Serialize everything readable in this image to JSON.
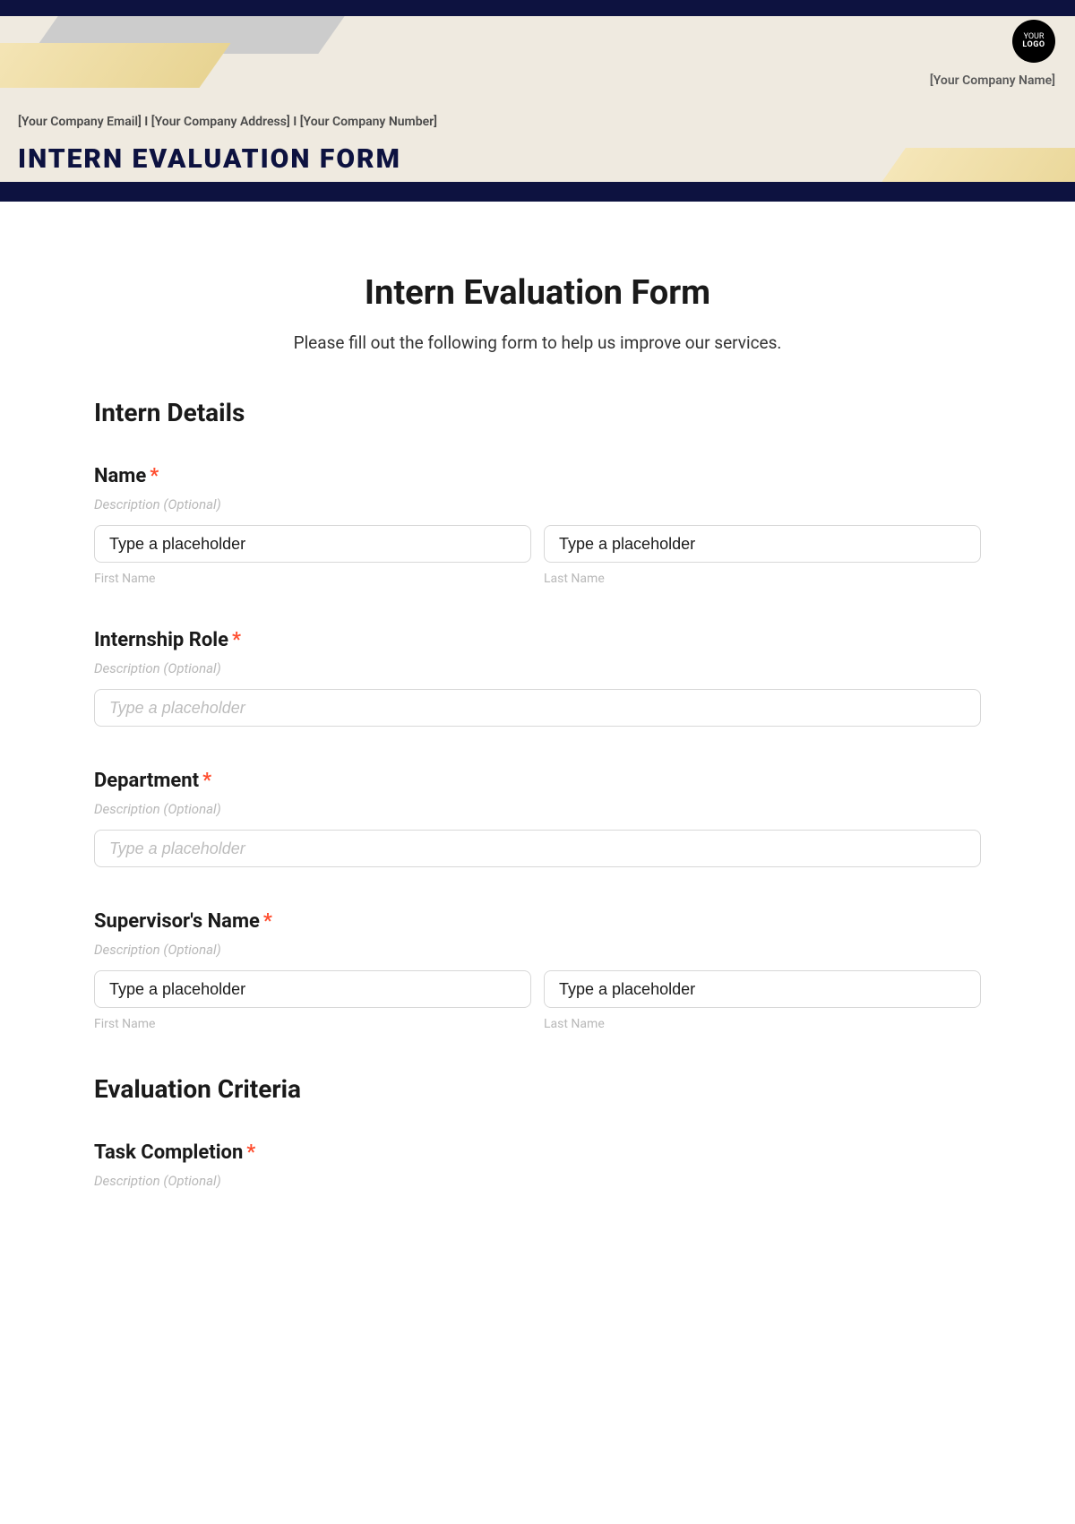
{
  "header": {
    "logo": {
      "line1": "YOUR",
      "line2": "LOGO"
    },
    "company_name": "[Your Company Name]",
    "contact": "[Your Company Email] I [Your Company Address] I [Your Company Number]",
    "title": "INTERN EVALUATION FORM"
  },
  "form": {
    "title": "Intern Evaluation Form",
    "subtitle": "Please fill out the following form to help us improve our services."
  },
  "sections": {
    "intern_details": {
      "title": "Intern Details"
    },
    "evaluation_criteria": {
      "title": "Evaluation Criteria"
    }
  },
  "fields": {
    "name": {
      "label": "Name",
      "desc": "Description (Optional)",
      "first_value": "Type a placeholder",
      "first_sub": "First Name",
      "last_value": "Type a placeholder",
      "last_sub": "Last Name"
    },
    "role": {
      "label": "Internship Role",
      "desc": "Description (Optional)",
      "placeholder": "Type a placeholder"
    },
    "department": {
      "label": "Department",
      "desc": "Description (Optional)",
      "placeholder": "Type a placeholder"
    },
    "supervisor": {
      "label": "Supervisor's Name",
      "desc": "Description (Optional)",
      "first_value": "Type a placeholder",
      "first_sub": "First Name",
      "last_value": "Type a placeholder",
      "last_sub": "Last Name"
    },
    "task_completion": {
      "label": "Task Completion",
      "desc": "Description (Optional)"
    }
  },
  "required": "*"
}
